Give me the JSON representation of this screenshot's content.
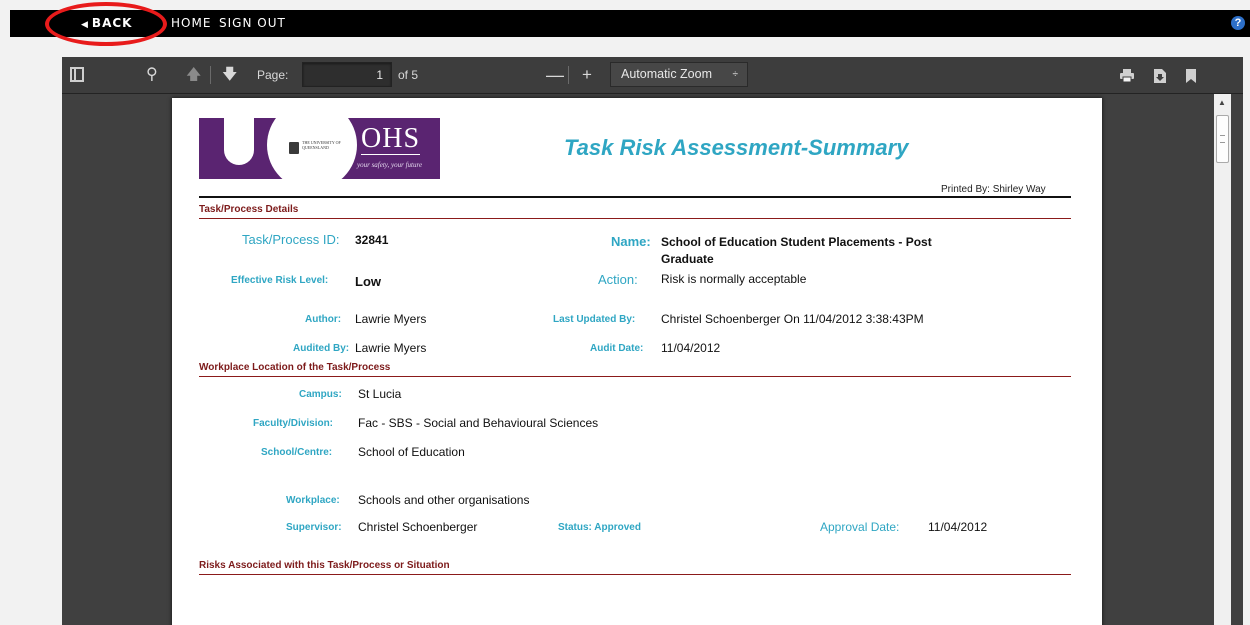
{
  "topnav": {
    "back": "BACK",
    "home": "HOME",
    "signout": "SIGN OUT",
    "help": "?"
  },
  "toolbar": {
    "page_label": "Page:",
    "page_value": "1",
    "page_of": "of 5",
    "zoom": "Automatic Zoom",
    "zoom_arrow": "÷"
  },
  "document": {
    "title": "Task Risk Assessment-Summary",
    "printed_by": "Printed By: Shirley Way",
    "logo": {
      "text": "OHS",
      "tagline": "your safety, your future",
      "university": "THE UNIVERSITY OF QUEENSLAND"
    },
    "sections": {
      "task_details": "Task/Process Details",
      "workplace_location": "Workplace Location of the Task/Process",
      "risks": "Risks Associated with this Task/Process or Situation"
    },
    "fields": {
      "task_id_label": "Task/Process ID:",
      "task_id": "32841",
      "name_label": "Name:",
      "name_line1": "School of Education Student Placements - Post",
      "name_line2": "Graduate",
      "risk_level_label": "Effective Risk Level:",
      "risk_level": "Low",
      "action_label": "Action:",
      "action": "Risk is normally acceptable",
      "author_label": "Author:",
      "author": "Lawrie Myers",
      "last_updated_label": "Last Updated By:",
      "last_updated": "Christel Schoenberger On 11/04/2012   3:38:43PM",
      "audited_by_label": "Audited By:",
      "audited_by": "Lawrie Myers",
      "audit_date_label": "Audit Date:",
      "audit_date": "11/04/2012",
      "campus_label": "Campus:",
      "campus": "St Lucia",
      "faculty_label": "Faculty/Division:",
      "faculty": "Fac - SBS - Social and Behavioural Sciences",
      "school_label": "School/Centre:",
      "school": "School of Education",
      "workplace_label": "Workplace:",
      "workplace": "Schools and other organisations",
      "supervisor_label": "Supervisor:",
      "supervisor": "Christel Schoenberger",
      "status": "Status: Approved",
      "approval_date_label": "Approval Date:",
      "approval_date": "11/04/2012"
    }
  },
  "colors": {
    "label": "#2fa6c3",
    "section": "#7d1b1b",
    "logo_bg": "#5a2471",
    "annotation": "#e81b1b"
  }
}
